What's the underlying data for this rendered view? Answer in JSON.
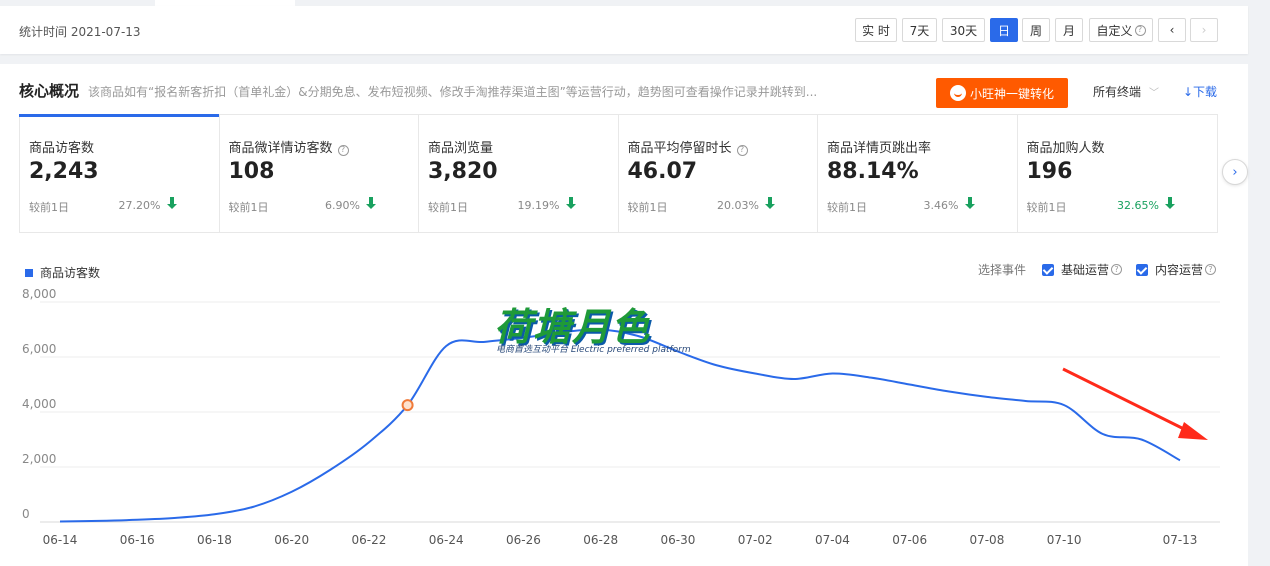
{
  "header": {
    "stat_time": "统计时间 2021-07-13",
    "buttons": [
      {
        "label": "实 时",
        "active": false
      },
      {
        "label": "7天",
        "active": false
      },
      {
        "label": "30天",
        "active": false
      },
      {
        "label": "日",
        "active": true
      },
      {
        "label": "周",
        "active": false
      },
      {
        "label": "月",
        "active": false
      }
    ],
    "custom_label": "自定义",
    "prev_icon": "chevron-left-icon",
    "next_icon": "chevron-right-icon"
  },
  "overview": {
    "title": "核心概况",
    "description": "该商品如有“报名新客折扣（首单礼金）&分期免息、发布短视频、修改手淘推荐渠道主图”等运营行动，趋势图可查看操作记录并跳转到...",
    "promo_button": "小旺神一键转化",
    "terminal_label": "所有终端",
    "download_label": "↓下载"
  },
  "metrics": [
    {
      "label": "商品访客数",
      "value": "2,243",
      "compare": "较前1日",
      "pct": "27.20%",
      "help": false,
      "selected": true,
      "green_pct": false
    },
    {
      "label": "商品微详情访客数",
      "value": "108",
      "compare": "较前1日",
      "pct": "6.90%",
      "help": true,
      "selected": false,
      "green_pct": false
    },
    {
      "label": "商品浏览量",
      "value": "3,820",
      "compare": "较前1日",
      "pct": "19.19%",
      "help": false,
      "selected": false,
      "green_pct": false
    },
    {
      "label": "商品平均停留时长",
      "value": "46.07",
      "compare": "较前1日",
      "pct": "20.03%",
      "help": true,
      "selected": false,
      "green_pct": false
    },
    {
      "label": "商品详情页跳出率",
      "value": "88.14%",
      "compare": "较前1日",
      "pct": "3.46%",
      "help": false,
      "selected": false,
      "green_pct": false
    },
    {
      "label": "商品加购人数",
      "value": "196",
      "compare": "较前1日",
      "pct": "32.65%",
      "help": false,
      "selected": false,
      "green_pct": true
    }
  ],
  "legend": {
    "label": "商品访客数",
    "color": "#2a6ae9"
  },
  "events": {
    "label": "选择事件",
    "items": [
      {
        "label": "基础运营",
        "checked": true
      },
      {
        "label": "内容运营",
        "checked": true
      }
    ]
  },
  "watermark": {
    "title": "荷塘月色",
    "subtitle": "电商首选互动平台 Electric preferred platform"
  },
  "chart_data": {
    "type": "line",
    "series": [
      {
        "name": "商品访客数",
        "color": "#2a6ae9",
        "x": [
          "06-14",
          "06-15",
          "06-16",
          "06-17",
          "06-18",
          "06-19",
          "06-20",
          "06-21",
          "06-22",
          "06-23",
          "06-24",
          "06-25",
          "06-26",
          "06-27",
          "06-28",
          "06-29",
          "06-30",
          "07-01",
          "07-02",
          "07-03",
          "07-04",
          "07-05",
          "07-06",
          "07-07",
          "07-08",
          "07-09",
          "07-10",
          "07-11",
          "07-12",
          "07-13"
        ],
        "values": [
          20,
          40,
          80,
          150,
          280,
          550,
          1100,
          1900,
          2900,
          4250,
          6400,
          6550,
          6700,
          6900,
          7000,
          6750,
          6200,
          5700,
          5400,
          5200,
          5400,
          5250,
          5000,
          4750,
          4550,
          4400,
          4250,
          3200,
          3000,
          2243
        ]
      }
    ],
    "highlight_index": 9,
    "x_tick_labels": [
      "06-14",
      "06-16",
      "06-18",
      "06-20",
      "06-22",
      "06-24",
      "06-26",
      "06-28",
      "06-30",
      "07-02",
      "07-04",
      "07-06",
      "07-08",
      "07-10",
      "07-13"
    ],
    "y_tick_labels": [
      "0",
      "2,000",
      "4,000",
      "6,000",
      "8,000"
    ],
    "ylim": [
      0,
      8000
    ],
    "grid": true,
    "annotation_arrow_color": "#ff2a1a"
  }
}
